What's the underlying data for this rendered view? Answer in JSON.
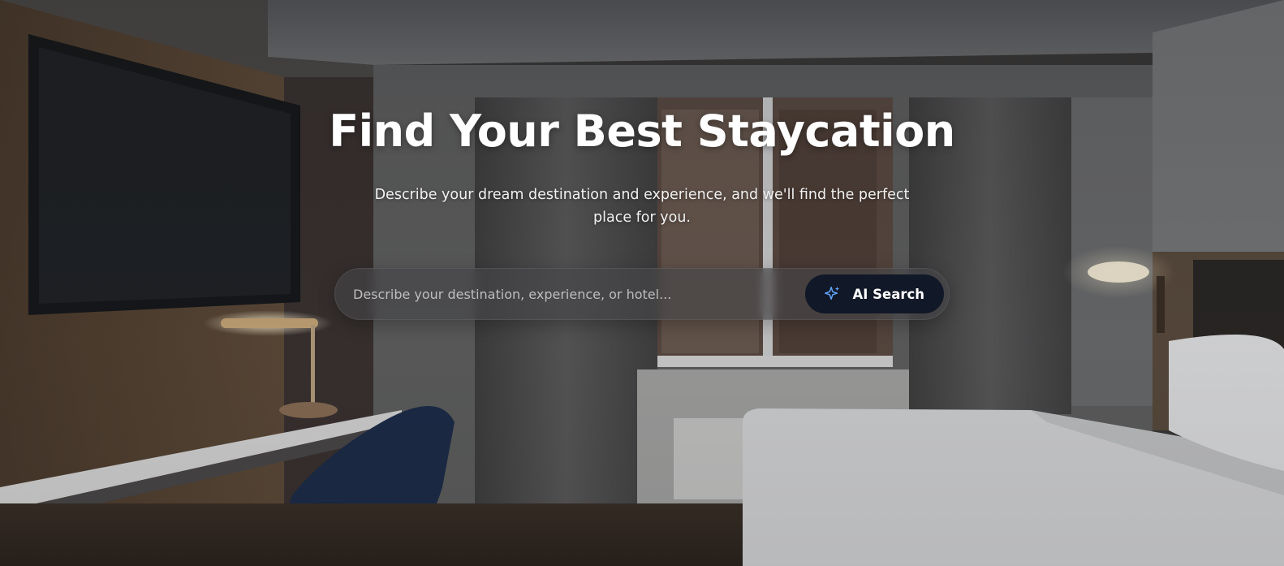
{
  "hero": {
    "title": "Find Your Best Staycation",
    "subtitle": "Describe your dream destination and experience, and we'll find the perfect place for you."
  },
  "search": {
    "placeholder": "Describe your destination, experience, or hotel...",
    "value": "",
    "button_label": "AI Search",
    "button_icon": "sparkle-icon"
  },
  "colors": {
    "button_background": "#111827",
    "button_text": "#ffffff",
    "icon_accent": "#60a5fa",
    "title_text": "#ffffff"
  },
  "background_image": "hotel-room-photo"
}
